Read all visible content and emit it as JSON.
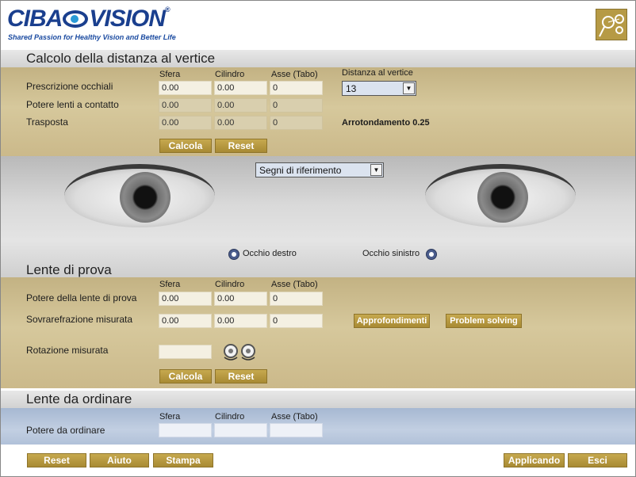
{
  "header": {
    "logo_left": "CIBA",
    "logo_right": "VISION",
    "logo_mark": "®",
    "tagline": "Shared Passion for Healthy Vision and Better Life",
    "tool_icon": "lens-tools-icon"
  },
  "section1": {
    "title": "Calcolo della distanza al vertice",
    "col_sfera": "Sfera",
    "col_cilindro": "Cilindro",
    "col_asse": "Asse (Tabo)",
    "distanza_label": "Distanza al vertice",
    "distanza_value": "13",
    "rows": [
      {
        "label": "Prescrizione occhiali",
        "sfera": "0.00",
        "cilindro": "0.00",
        "asse": "0"
      },
      {
        "label": "Potere lenti a contatto",
        "sfera": "0.00",
        "cilindro": "0.00",
        "asse": "0"
      },
      {
        "label": "Trasposta",
        "sfera": "0.00",
        "cilindro": "0.00",
        "asse": "0"
      }
    ],
    "arrotondamento": "Arrotondamento 0.25",
    "calcola": "Calcola",
    "reset": "Reset"
  },
  "eyes": {
    "select_value": "Segni di riferimento",
    "right_eye": "Occhio destro",
    "left_eye": "Occhio sinistro"
  },
  "section2": {
    "title": "Lente di prova",
    "col_sfera": "Sfera",
    "col_cilindro": "Cilindro",
    "col_asse": "Asse (Tabo)",
    "rows": [
      {
        "label": "Potere della lente di prova",
        "sfera": "0.00",
        "cilindro": "0.00",
        "asse": "0"
      },
      {
        "label": "Sovrarefrazione misurata",
        "sfera": "0.00",
        "cilindro": "0.00",
        "asse": "0"
      }
    ],
    "rotazione_label": "Rotazione misurata",
    "rotazione_value": "",
    "approfondimenti": "Approfondimenti",
    "problem_solving": "Problem solving",
    "calcola": "Calcola",
    "reset": "Reset"
  },
  "section3": {
    "title": "Lente da ordinare",
    "col_sfera": "Sfera",
    "col_cilindro": "Cilindro",
    "col_asse": "Asse (Tabo)",
    "row_label": "Potere da ordinare",
    "sfera": "",
    "cilindro": "",
    "asse": ""
  },
  "footer": {
    "reset": "Reset",
    "aiuto": "Aiuto",
    "stampa": "Stampa",
    "applicando": "Applicando",
    "esci": "Esci"
  },
  "colors": {
    "brand_blue": "#1a3f8e",
    "button_gold": "#b69a45",
    "panel_gold": "#cbb98a",
    "panel_blue": "#b1c1d9"
  }
}
